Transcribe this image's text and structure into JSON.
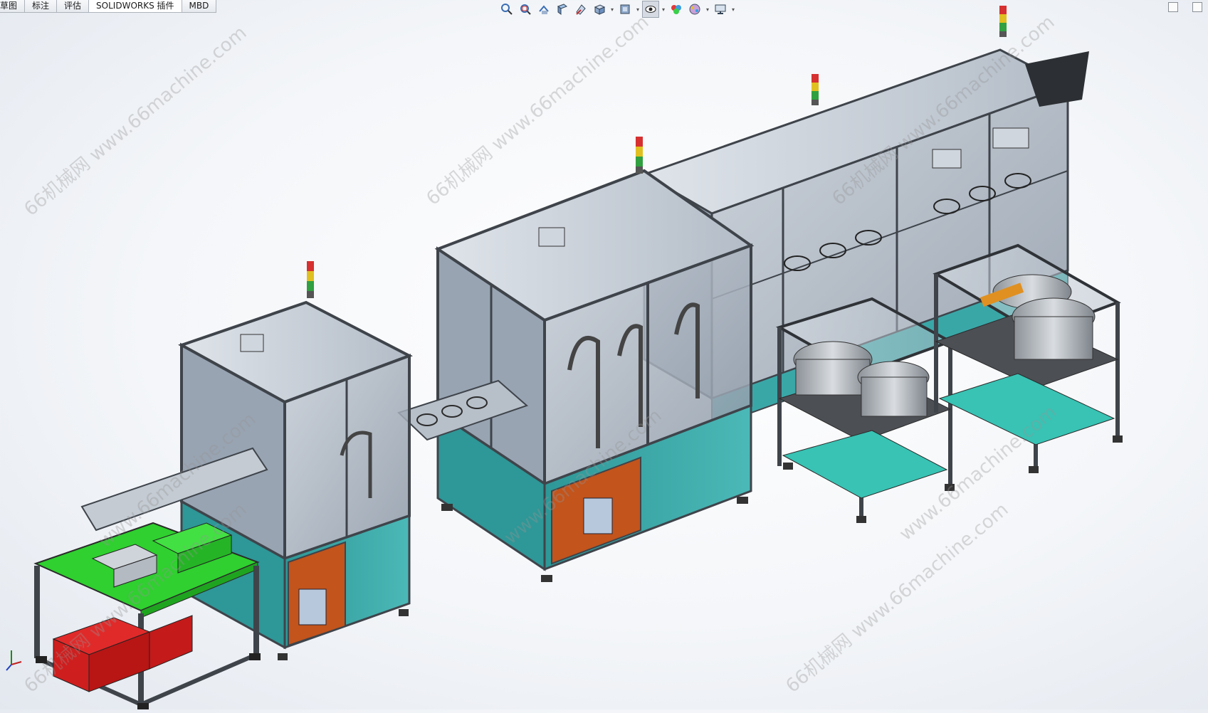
{
  "command_manager": {
    "tabs": [
      {
        "label": "草图",
        "active": false
      },
      {
        "label": "标注",
        "active": false
      },
      {
        "label": "评估",
        "active": false
      },
      {
        "label": "SOLIDWORKS 插件",
        "active": true
      },
      {
        "label": "MBD",
        "active": false
      }
    ]
  },
  "heads_up_toolbar": {
    "buttons": [
      "zoom-to-fit-icon",
      "zoom-to-area-icon",
      "previous-view-icon",
      "section-view-icon",
      "dynamic-annotation-icon",
      "view-orientation-icon",
      "display-style-icon",
      "hide-show-items-icon",
      "edit-appearance-icon",
      "apply-scene-icon",
      "view-settings-icon"
    ]
  },
  "watermarks": [
    {
      "text": "66机械网 www.66machine.com"
    },
    {
      "text": "66机械网 www.66machine.com"
    },
    {
      "text": "66机械网 www.66machine.com"
    },
    {
      "text": "www.66machine.com"
    },
    {
      "text": "www.66machine.com"
    },
    {
      "text": "www.66machine.com"
    },
    {
      "text": "66机械网 www.66machine.com"
    },
    {
      "text": "66机械网 www.66machine.com"
    }
  ],
  "colors": {
    "frame": "#4a4f57",
    "glass": "#9aa6b4",
    "cabinet_teal": "#3aa7a7",
    "cabinet_orange": "#c2541c",
    "table_green": "#2fd02f",
    "bins_red": "#d81d1d",
    "floor_teal": "#38c3b4"
  }
}
